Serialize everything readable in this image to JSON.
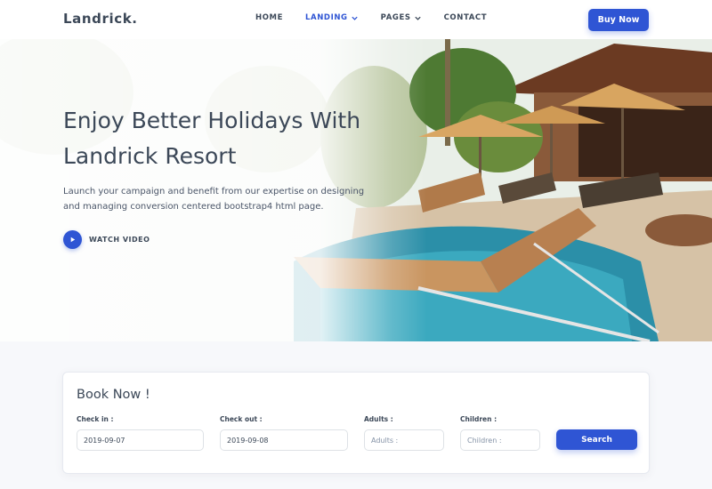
{
  "header": {
    "logo": "Landrick.",
    "nav": [
      {
        "label": "HOME",
        "dropdown": false,
        "active": false
      },
      {
        "label": "LANDING",
        "dropdown": true,
        "active": true
      },
      {
        "label": "PAGES",
        "dropdown": true,
        "active": false
      },
      {
        "label": "CONTACT",
        "dropdown": false,
        "active": false
      }
    ],
    "buy_label": "Buy Now"
  },
  "hero": {
    "title_line1": "Enjoy Better Holidays With",
    "title_line2": "Landrick Resort",
    "description": "Launch your campaign and benefit from our expertise on designing and managing conversion centered bootstrap4 html page.",
    "watch_label": "WATCH VIDEO",
    "image": "resort-pool-photo"
  },
  "booking": {
    "title": "Book Now !",
    "checkin": {
      "label": "Check in :",
      "value": "2019-09-07"
    },
    "checkout": {
      "label": "Check out :",
      "value": "2019-09-08"
    },
    "adults": {
      "label": "Adults :",
      "placeholder": "Adults :"
    },
    "children": {
      "label": "Children :",
      "placeholder": "Children :"
    },
    "search_label": "Search"
  },
  "colors": {
    "accent": "#2f55d4",
    "text": "#3c4858",
    "background": "#f7f8fb"
  }
}
